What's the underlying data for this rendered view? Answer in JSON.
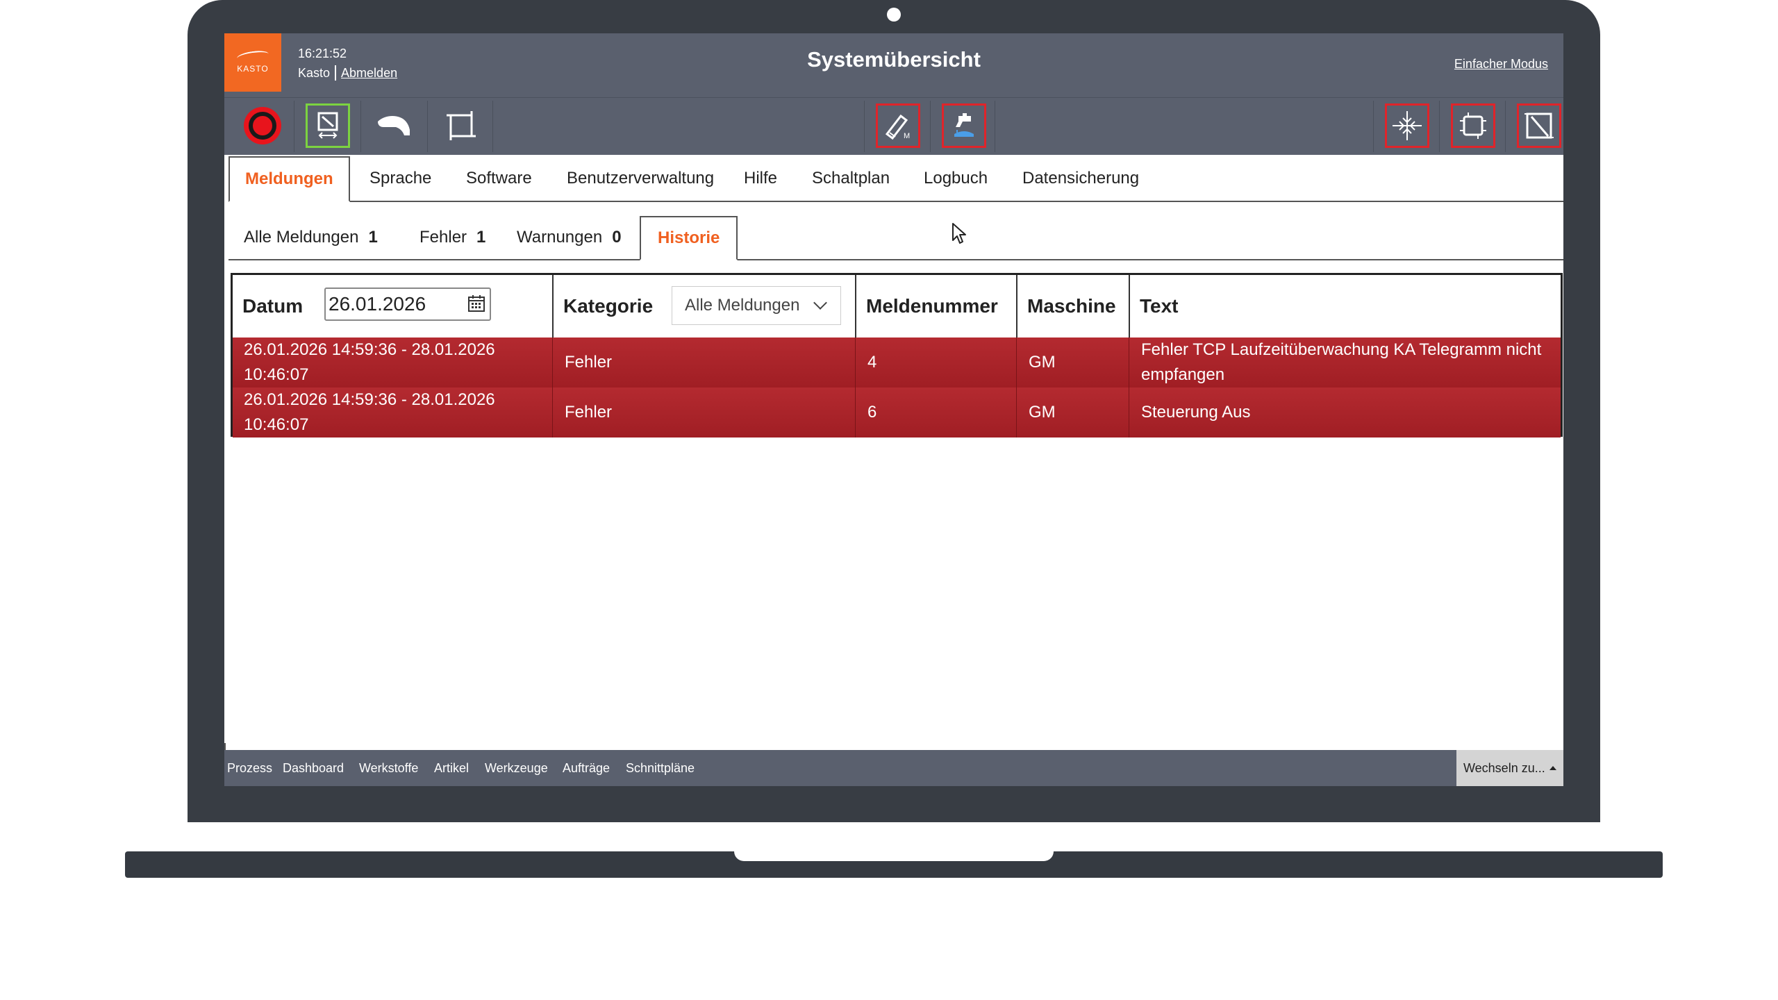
{
  "header": {
    "logo_text": "KASTO",
    "time": "16:21:52",
    "user": "Kasto",
    "logout_label": "Abmelden",
    "title": "Systemübersicht",
    "mode_link": "Einfacher Modus"
  },
  "toolbar": {
    "icons": [
      "stop-record-icon",
      "saw-feed-icon",
      "hand-icon",
      "frame-icon",
      "material-edit-icon",
      "coolant-icon",
      "center-icon",
      "chip-icon",
      "cut-diagonal-icon"
    ]
  },
  "tabs": [
    {
      "label": "Meldungen"
    },
    {
      "label": "Sprache"
    },
    {
      "label": "Software"
    },
    {
      "label": "Benutzerverwaltung"
    },
    {
      "label": "Hilfe"
    },
    {
      "label": "Schaltplan"
    },
    {
      "label": "Logbuch"
    },
    {
      "label": "Datensicherung"
    }
  ],
  "subtabs": [
    {
      "label": "Alle Meldungen",
      "count": "1"
    },
    {
      "label": "Fehler",
      "count": "1"
    },
    {
      "label": "Warnungen",
      "count": "0"
    },
    {
      "label": "Historie"
    }
  ],
  "grid": {
    "columns": [
      "Datum",
      "Kategorie",
      "Meldenummer",
      "Maschine",
      "Text"
    ],
    "date_value": "26.01.2026",
    "category_selected": "Alle Meldungen",
    "rows": [
      {
        "datum_line1": "26.01.2026 14:59:36 - 28.01.2026",
        "datum_line2": "10:46:07",
        "kategorie": "Fehler",
        "nummer": "4",
        "maschine": "GM",
        "text_line1": "Fehler TCP Laufzeitüberwachung KA Telegramm nicht",
        "text_line2": "empfangen"
      },
      {
        "datum_line1": "26.01.2026 14:59:36 - 28.01.2026",
        "datum_line2": "10:46:07",
        "kategorie": "Fehler",
        "nummer": "6",
        "maschine": "GM",
        "text_line1": "Steuerung Aus",
        "text_line2": ""
      }
    ]
  },
  "footer": {
    "items": [
      "Prozess",
      "Dashboard",
      "Werkstoffe",
      "Artikel",
      "Werkzeuge",
      "Aufträge",
      "Schnittpläne"
    ],
    "switch_label": "Wechseln zu..."
  },
  "colors": {
    "accent": "#f06020",
    "header_bg": "#5a606e",
    "error_row": "#a8242a",
    "highlight_border": "#e0242a"
  }
}
